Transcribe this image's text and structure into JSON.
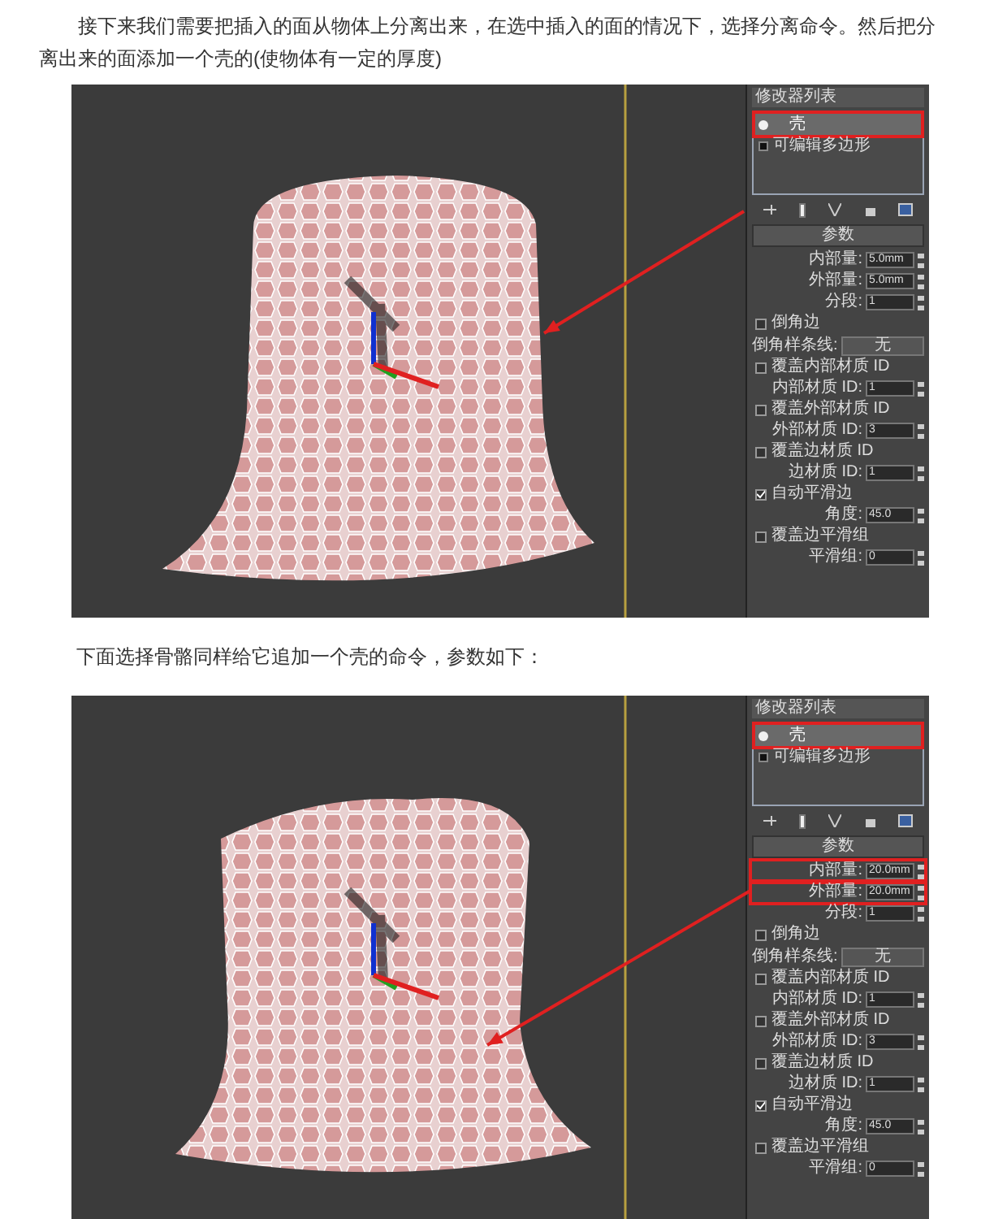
{
  "paragraphs": [
    "接下来我们需要把插入的面从物体上分离出来，在选中插入的面的情况下，选择分离命令。然后把分离出来的面添加一个壳的(使物体有一定的厚度)",
    "下面选择骨骼同样给它追加一个壳的命令，参数如下："
  ],
  "screenshots": [
    {
      "modifier_list_label": "修改器列表",
      "stack": [
        {
          "kind": "modifier",
          "label": "壳",
          "selected": true,
          "highlighted": true
        },
        {
          "kind": "base",
          "label": "可编辑多边形",
          "selected": false,
          "highlighted": false
        }
      ],
      "rollout_title": "参数",
      "params": [
        {
          "kind": "spinner",
          "label": "内部量:",
          "value": "5.0mm",
          "highlighted": false
        },
        {
          "kind": "spinner",
          "label": "外部量:",
          "value": "5.0mm",
          "highlighted": false
        },
        {
          "kind": "spinner",
          "label": "分段:",
          "value": "1",
          "highlighted": false
        },
        {
          "kind": "checkbox",
          "label": "倒角边",
          "checked": false
        },
        {
          "kind": "button",
          "label": "倒角样条线:",
          "value": "无"
        },
        {
          "kind": "checkbox",
          "label": "覆盖内部材质 ID",
          "checked": false
        },
        {
          "kind": "spinner",
          "label": "内部材质 ID:",
          "value": "1",
          "highlighted": false
        },
        {
          "kind": "checkbox",
          "label": "覆盖外部材质 ID",
          "checked": false
        },
        {
          "kind": "spinner",
          "label": "外部材质 ID:",
          "value": "3",
          "highlighted": false
        },
        {
          "kind": "checkbox",
          "label": "覆盖边材质 ID",
          "checked": false
        },
        {
          "kind": "spinner",
          "label": "边材质 ID:",
          "value": "1",
          "highlighted": false
        },
        {
          "kind": "checkbox",
          "label": "自动平滑边",
          "checked": true
        },
        {
          "kind": "spinner",
          "label": "角度:",
          "value": "45.0",
          "highlighted": false
        },
        {
          "kind": "checkbox",
          "label": "覆盖边平滑组",
          "checked": false
        },
        {
          "kind": "spinner",
          "label": "平滑组:",
          "value": "0",
          "highlighted": false
        }
      ]
    },
    {
      "modifier_list_label": "修改器列表",
      "stack": [
        {
          "kind": "modifier",
          "label": "壳",
          "selected": true,
          "highlighted": true
        },
        {
          "kind": "base",
          "label": "可编辑多边形",
          "selected": false,
          "highlighted": false
        }
      ],
      "rollout_title": "参数",
      "params": [
        {
          "kind": "spinner",
          "label": "内部量:",
          "value": "20.0mm",
          "highlighted": true
        },
        {
          "kind": "spinner",
          "label": "外部量:",
          "value": "20.0mm",
          "highlighted": true
        },
        {
          "kind": "spinner",
          "label": "分段:",
          "value": "1",
          "highlighted": false
        },
        {
          "kind": "checkbox",
          "label": "倒角边",
          "checked": false
        },
        {
          "kind": "button",
          "label": "倒角样条线:",
          "value": "无"
        },
        {
          "kind": "checkbox",
          "label": "覆盖内部材质 ID",
          "checked": false
        },
        {
          "kind": "spinner",
          "label": "内部材质 ID:",
          "value": "1",
          "highlighted": false
        },
        {
          "kind": "checkbox",
          "label": "覆盖外部材质 ID",
          "checked": false
        },
        {
          "kind": "spinner",
          "label": "外部材质 ID:",
          "value": "3",
          "highlighted": false
        },
        {
          "kind": "checkbox",
          "label": "覆盖边材质 ID",
          "checked": false
        },
        {
          "kind": "spinner",
          "label": "边材质 ID:",
          "value": "1",
          "highlighted": false
        },
        {
          "kind": "checkbox",
          "label": "自动平滑边",
          "checked": true
        },
        {
          "kind": "spinner",
          "label": "角度:",
          "value": "45.0",
          "highlighted": false
        },
        {
          "kind": "checkbox",
          "label": "覆盖边平滑组",
          "checked": false
        },
        {
          "kind": "spinner",
          "label": "平滑组:",
          "value": "0",
          "highlighted": false
        }
      ]
    }
  ]
}
